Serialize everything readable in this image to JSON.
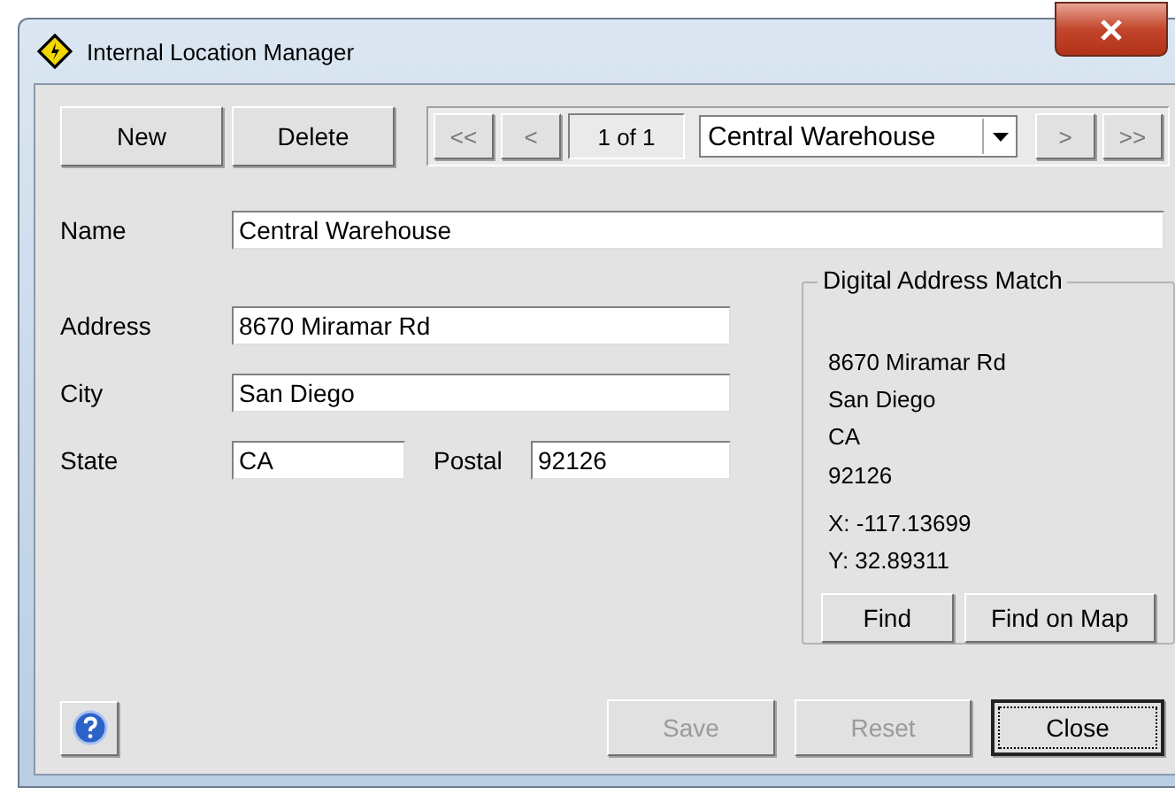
{
  "window": {
    "title": "Internal Location Manager"
  },
  "toolbar": {
    "buttons": [
      {
        "label": "New",
        "disabled": false
      },
      {
        "label": "Delete",
        "disabled": false
      }
    ],
    "navigator": {
      "first": "<<",
      "previous": "<",
      "position": "1 of 1",
      "record": "Central Warehouse",
      "next": ">",
      "last": ">>"
    }
  },
  "form": {
    "name": {
      "label": "Name",
      "value": "Central Warehouse"
    },
    "address": {
      "label": "Address",
      "value": "8670 Miramar Rd"
    },
    "city": {
      "label": "City",
      "value": "San Diego"
    },
    "state": {
      "label": "State",
      "value": "CA"
    },
    "postal": {
      "label": "Postal",
      "value": "92126"
    }
  },
  "digital_address_match": {
    "title": "Digital Address Match",
    "lines": [
      "8670 Miramar Rd",
      "San Diego",
      "CA",
      "92126"
    ],
    "x": "X: -117.13699",
    "y": "Y: 32.89311",
    "buttons": [
      {
        "label": "Find",
        "disabled": false
      },
      {
        "label": "Find on Map",
        "disabled": false
      }
    ]
  },
  "footer": {
    "buttons": [
      {
        "label": "Save",
        "disabled": true
      },
      {
        "label": "Reset",
        "disabled": true
      },
      {
        "label": "Close",
        "disabled": false,
        "focused": true
      }
    ]
  }
}
